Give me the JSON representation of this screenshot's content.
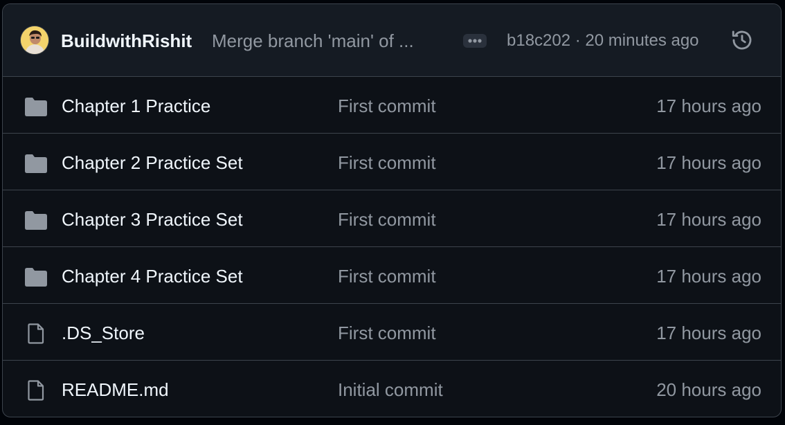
{
  "header": {
    "author": "BuildwithRishit",
    "commit_message": "Merge branch 'main' of ...",
    "commit_meta": "b18c202 · 20 minutes ago"
  },
  "files": [
    {
      "name": "Chapter 1 Practice",
      "type": "folder",
      "message": "First commit",
      "time": "17 hours ago"
    },
    {
      "name": "Chapter 2 Practice Set",
      "type": "folder",
      "message": "First commit",
      "time": "17 hours ago"
    },
    {
      "name": "Chapter 3 Practice Set",
      "type": "folder",
      "message": "First commit",
      "time": "17 hours ago"
    },
    {
      "name": "Chapter 4 Practice Set",
      "type": "folder",
      "message": "First commit",
      "time": "17 hours ago"
    },
    {
      "name": ".DS_Store",
      "type": "file",
      "message": "First commit",
      "time": "17 hours ago"
    },
    {
      "name": "README.md",
      "type": "file",
      "message": "Initial commit",
      "time": "20 hours ago"
    }
  ],
  "colors": {
    "background": "#0d1117",
    "header_bg": "#151b23",
    "border": "#3d444d",
    "text_primary": "#f0f6fc",
    "text_muted": "#9198a1",
    "avatar_bg": "#f3d36b"
  },
  "icons": {
    "folder": "folder-icon",
    "file": "file-icon",
    "more": "kebab-horizontal-icon",
    "history": "history-icon"
  }
}
